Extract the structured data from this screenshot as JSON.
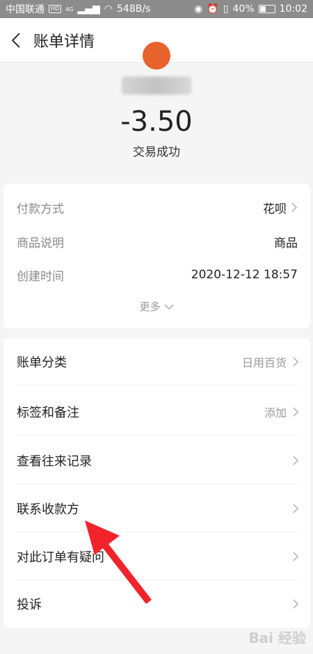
{
  "status_bar": {
    "carrier": "中国联通",
    "hd": "HD",
    "net": "4G",
    "speed": "548B/s",
    "battery": "40%",
    "time": "10:02"
  },
  "nav": {
    "title": "账单详情"
  },
  "summary": {
    "amount": "-3.50",
    "status": "交易成功"
  },
  "details": [
    {
      "label": "付款方式",
      "value": "花呗"
    },
    {
      "label": "商品说明",
      "value": "商品"
    },
    {
      "label": "创建时间",
      "value": "2020-12-12 18:57"
    }
  ],
  "more_label": "更多",
  "menu": [
    {
      "label": "账单分类",
      "value": "日用百货"
    },
    {
      "label": "标签和备注",
      "value": "添加"
    },
    {
      "label": "查看往来记录",
      "value": ""
    },
    {
      "label": "联系收款方",
      "value": ""
    },
    {
      "label": "对此订单有疑问",
      "value": ""
    },
    {
      "label": "投诉",
      "value": ""
    }
  ],
  "watermark": "Bai 经验"
}
